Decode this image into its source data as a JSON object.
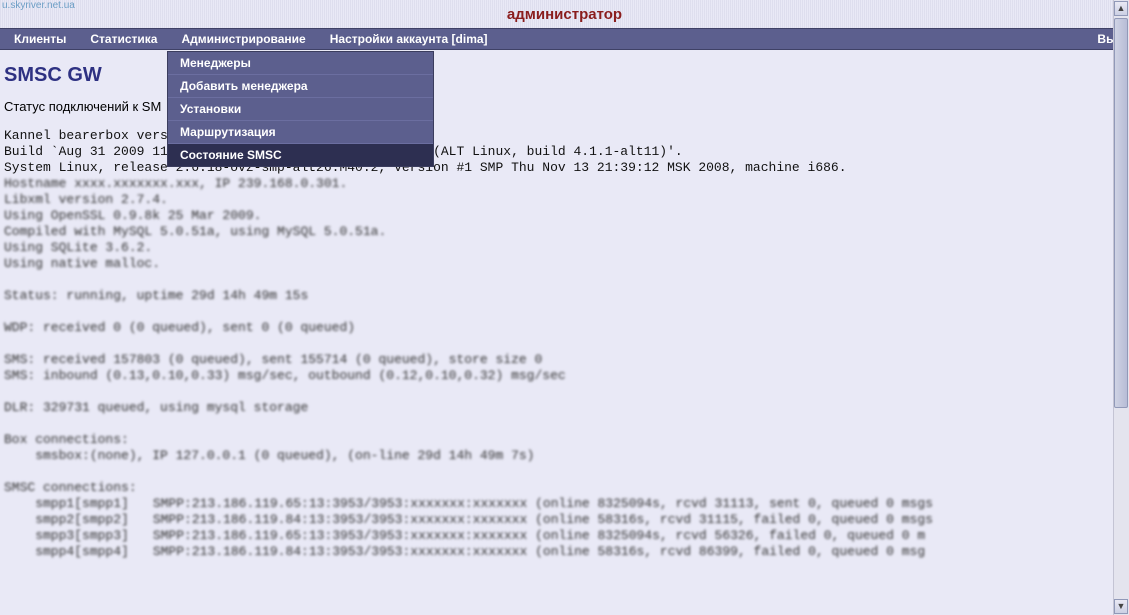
{
  "header": {
    "status_link": "u.skyriver.net.ua",
    "title": "администратор"
  },
  "menu": {
    "items": [
      "Клиенты",
      "Статистика",
      "Администрирование",
      "Настройки аккаунта [dima]"
    ],
    "right": "Вых"
  },
  "dropdown": {
    "items": [
      {
        "label": "Менеджеры",
        "active": false
      },
      {
        "label": "Добавить менеджера",
        "active": false
      },
      {
        "label": "Установки",
        "active": false
      },
      {
        "label": "Маршрутизация",
        "active": false
      },
      {
        "label": "Состояние SMSC",
        "active": true
      }
    ]
  },
  "page": {
    "heading": "SMSC GW",
    "subtitle_prefix": "Статус подключений к SM",
    "log_lines": [
      "Kannel bearerbox vers",
      "Build `Aug 31 2009 11:46:29', compiler `4.1.1 20070105 (ALT Linux, build 4.1.1-alt11)'.",
      "System Linux, release 2.6.18-ovz-smp-alt26.M40.2, version #1 SMP Thu Nov 13 21:39:12 MSK 2008, machine i686."
    ],
    "obscured_block1": [
      "Hostname xxxx.xxxxxxx.xxx, IP 239.168.0.301.",
      "Libxml version 2.7.4.",
      "Using OpenSSL 0.9.8k 25 Mar 2009.",
      "Compiled with MySQL 5.0.51a, using MySQL 5.0.51a.",
      "Using SQLite 3.6.2.",
      "Using native malloc."
    ],
    "obscured_block2": [
      "Status: running, uptime 29d 14h 49m 15s"
    ],
    "obscured_block3": [
      "WDP: received 0 (0 queued), sent 0 (0 queued)"
    ],
    "obscured_block4": [
      "SMS: received 157803 (0 queued), sent 155714 (0 queued), store size 0",
      "SMS: inbound (0.13,0.10,0.33) msg/sec, outbound (0.12,0.10,0.32) msg/sec"
    ],
    "obscured_block5": [
      "DLR: 329731 queued, using mysql storage"
    ],
    "obscured_block6": [
      "Box connections:",
      "    smsbox:(none), IP 127.0.0.1 (0 queued), (on-line 29d 14h 49m 7s)"
    ],
    "obscured_block7": [
      "SMSC connections:"
    ],
    "obscured_cols_left": [
      "    smpp1[smpp1]",
      "    smpp2[smpp2]",
      "    smpp3[smpp3]",
      "    smpp4[smpp4]"
    ],
    "obscured_cols_right": [
      "SMPP:213.186.119.65:13:3953/3953:xxxxxxx:xxxxxxx (online 8325094s, rcvd 31113, sent 0, queued 0 msgs",
      "SMPP:213.186.119.84:13:3953/3953:xxxxxxx:xxxxxxx (online 58316s, rcvd 31115, failed 0, queued 0 msgs",
      "SMPP:213.186.119.65:13:3953/3953:xxxxxxx:xxxxxxx (online 8325094s, rcvd 56326, failed 0, queued 0 m",
      "SMPP:213.186.119.84:13:3953/3953:xxxxxxx:xxxxxxx (online 58316s, rcvd 86399, failed 0, queued 0 msg"
    ]
  }
}
